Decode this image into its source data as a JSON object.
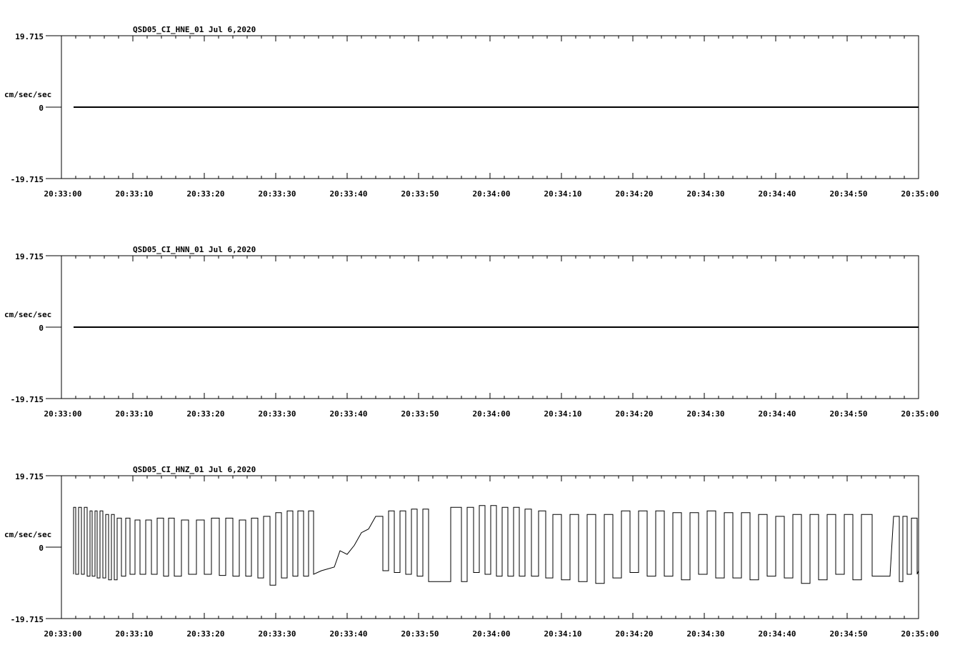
{
  "colors": {
    "background": "#ffffff",
    "ink": "#000000"
  },
  "chart_data": [
    {
      "type": "line",
      "title": "QSD05_CI_HNE_01  Jul 6,2020",
      "ylabel": "cm/sec/sec",
      "ylim": [
        -19.715,
        19.715
      ],
      "yticks": [
        19.715,
        0,
        -19.715
      ],
      "ytick_labels": [
        "19.715",
        "0",
        "-19.715"
      ],
      "xlim": [
        "20:33:00",
        "20:35:00"
      ],
      "xtick_labels": [
        "20:33:00",
        "20:33:10",
        "20:33:20",
        "20:33:30",
        "20:33:40",
        "20:33:50",
        "20:34:00",
        "20:34:10",
        "20:34:20",
        "20:34:30",
        "20:34:40",
        "20:34:50",
        "20:35:00"
      ],
      "series": [
        {
          "segments": [
            {
              "x": [
                "20:33:01.7",
                "20:35:00"
              ],
              "y": [
                0,
                0
              ]
            }
          ]
        }
      ]
    },
    {
      "type": "line",
      "title": "QSD05_CI_HNN_01  Jul 6,2020",
      "ylabel": "cm/sec/sec",
      "ylim": [
        -19.715,
        19.715
      ],
      "yticks": [
        19.715,
        0,
        -19.715
      ],
      "ytick_labels": [
        "19.715",
        "0",
        "-19.715"
      ],
      "xlim": [
        "20:33:00",
        "20:35:00"
      ],
      "xtick_labels": [
        "20:33:00",
        "20:33:10",
        "20:33:20",
        "20:33:30",
        "20:33:40",
        "20:33:50",
        "20:34:00",
        "20:34:10",
        "20:34:20",
        "20:34:30",
        "20:34:40",
        "20:34:50",
        "20:35:00"
      ],
      "series": [
        {
          "segments": [
            {
              "x": [
                "20:33:01.7",
                "20:35:00"
              ],
              "y": [
                0,
                0
              ]
            }
          ]
        }
      ]
    },
    {
      "type": "line",
      "title": "QSD05_CI_HNZ_01  Jul 6,2020",
      "ylabel": "cm/sec/sec",
      "ylim": [
        -19.715,
        19.715
      ],
      "yticks": [
        19.715,
        0,
        -19.715
      ],
      "ytick_labels": [
        "19.715",
        "0",
        "-19.715"
      ],
      "xlim": [
        "20:33:00",
        "20:35:00"
      ],
      "xtick_labels": [
        "20:33:00",
        "20:33:10",
        "20:33:20",
        "20:33:30",
        "20:33:40",
        "20:33:50",
        "20:34:00",
        "20:34:10",
        "20:34:20",
        "20:34:30",
        "20:34:40",
        "20:34:50",
        "20:35:00"
      ],
      "series": [
        {
          "segments": [
            {
              "x": [
                "20:33:01.7",
                "20:33:01.7",
                "20:33:02.0",
                "20:33:02.0",
                "20:33:02.4",
                "20:33:02.4",
                "20:33:02.8",
                "20:33:02.8",
                "20:33:03.2",
                "20:33:03.2",
                "20:33:03.6",
                "20:33:03.6",
                "20:33:04.0",
                "20:33:04.0",
                "20:33:04.3",
                "20:33:04.3",
                "20:33:04.7",
                "20:33:04.7",
                "20:33:05.0",
                "20:33:05.0",
                "20:33:05.4",
                "20:33:05.4",
                "20:33:05.8",
                "20:33:05.8",
                "20:33:06.2",
                "20:33:06.2",
                "20:33:06.6",
                "20:33:06.6",
                "20:33:07.0",
                "20:33:07.0",
                "20:33:07.4",
                "20:33:07.4",
                "20:33:07.8",
                "20:33:07.8",
                "20:33:08.4",
                "20:33:08.4",
                "20:33:09.0",
                "20:33:09.0",
                "20:33:09.6",
                "20:33:09.6",
                "20:33:10.3",
                "20:33:10.3",
                "20:33:11.0",
                "20:33:11.0",
                "20:33:11.8",
                "20:33:11.8",
                "20:33:12.6",
                "20:33:12.6",
                "20:33:13.4",
                "20:33:13.4",
                "20:33:14.3",
                "20:33:14.3",
                "20:33:15.0",
                "20:33:15.0",
                "20:33:15.8",
                "20:33:15.8",
                "20:33:16.8",
                "20:33:16.8",
                "20:33:17.8",
                "20:33:17.8",
                "20:33:18.9",
                "20:33:18.9",
                "20:33:20.0",
                "20:33:20.0",
                "20:33:21.0",
                "20:33:21.0",
                "20:33:22.1",
                "20:33:22.1",
                "20:33:23.0",
                "20:33:23.0",
                "20:33:24.0",
                "20:33:24.0",
                "20:33:24.9",
                "20:33:24.9",
                "20:33:25.8",
                "20:33:25.8",
                "20:33:26.6",
                "20:33:26.6",
                "20:33:27.5",
                "20:33:27.5",
                "20:33:28.3",
                "20:33:28.3",
                "20:33:29.2",
                "20:33:29.2",
                "20:33:30.0",
                "20:33:30.0",
                "20:33:30.8",
                "20:33:30.8",
                "20:33:31.6",
                "20:33:31.6",
                "20:33:32.4",
                "20:33:32.4",
                "20:33:33.1",
                "20:33:33.1",
                "20:33:33.9",
                "20:33:33.9",
                "20:33:34.6",
                "20:33:34.6",
                "20:33:35.3",
                "20:33:35.3",
                "20:33:36.4",
                "20:33:38.2",
                "20:33:39.0",
                "20:33:40.0",
                "20:33:41.0",
                "20:33:42.0",
                "20:33:43.0",
                "20:33:44.0",
                "20:33:45.0",
                "20:33:45.0",
                "20:33:45.8",
                "20:33:45.8",
                "20:33:46.6",
                "20:33:46.6",
                "20:33:47.4",
                "20:33:47.4",
                "20:33:48.2",
                "20:33:48.2",
                "20:33:49.0",
                "20:33:49.0",
                "20:33:49.8",
                "20:33:49.8",
                "20:33:50.6",
                "20:33:50.6",
                "20:33:51.4",
                "20:33:51.4",
                "20:33:54.5",
                "20:33:54.5",
                "20:33:56.0",
                "20:33:56.0",
                "20:33:56.8",
                "20:33:56.8",
                "20:33:57.7",
                "20:33:57.7",
                "20:33:58.5",
                "20:33:58.5",
                "20:33:59.3",
                "20:33:59.3",
                "20:34:00.1",
                "20:34:00.1",
                "20:34:00.9",
                "20:34:00.9",
                "20:34:01.7",
                "20:34:01.7",
                "20:34:02.5",
                "20:34:02.5",
                "20:34:03.3",
                "20:34:03.3",
                "20:34:04.1",
                "20:34:04.1",
                "20:34:04.9",
                "20:34:04.9",
                "20:34:05.8",
                "20:34:05.8",
                "20:34:06.8",
                "20:34:06.8",
                "20:34:07.8",
                "20:34:07.8",
                "20:34:08.8",
                "20:34:08.8",
                "20:34:10.0",
                "20:34:10.0",
                "20:34:11.2",
                "20:34:11.2",
                "20:34:12.4",
                "20:34:12.4",
                "20:34:13.6",
                "20:34:13.6",
                "20:34:14.8",
                "20:34:14.8",
                "20:34:16.0",
                "20:34:16.0",
                "20:34:17.2",
                "20:34:17.2",
                "20:34:18.4",
                "20:34:18.4",
                "20:34:19.6",
                "20:34:19.6",
                "20:34:20.8",
                "20:34:20.8",
                "20:34:22.0",
                "20:34:22.0",
                "20:34:23.2",
                "20:34:23.2",
                "20:34:24.4",
                "20:34:24.4",
                "20:34:25.6",
                "20:34:25.6",
                "20:34:26.8",
                "20:34:26.8",
                "20:34:28.0",
                "20:34:28.0",
                "20:34:29.2",
                "20:34:29.2",
                "20:34:30.4",
                "20:34:30.4",
                "20:34:31.6",
                "20:34:31.6",
                "20:34:32.8",
                "20:34:32.8",
                "20:34:34.0",
                "20:34:34.0",
                "20:34:35.2",
                "20:34:35.2",
                "20:34:36.4",
                "20:34:36.4",
                "20:34:37.6",
                "20:34:37.6",
                "20:34:38.8",
                "20:34:38.8",
                "20:34:40.0",
                "20:34:40.0",
                "20:34:41.2",
                "20:34:41.2",
                "20:34:42.4",
                "20:34:42.4",
                "20:34:43.6",
                "20:34:43.6",
                "20:34:44.8",
                "20:34:44.8",
                "20:34:46.0",
                "20:34:46.0",
                "20:34:47.2",
                "20:34:47.2",
                "20:34:48.4",
                "20:34:48.4",
                "20:34:49.6",
                "20:34:49.6",
                "20:34:50.8",
                "20:34:50.8",
                "20:34:52.0",
                "20:34:52.0",
                "20:34:53.5",
                "20:34:53.5",
                "20:34:56.0",
                "20:34:56.5",
                "20:34:57.3",
                "20:34:57.3",
                "20:34:57.8",
                "20:34:57.8",
                "20:34:58.4",
                "20:34:58.4",
                "20:34:59.0",
                "20:34:59.0",
                "20:34:59.8",
                "20:34:59.8",
                "20:35:00"
              ],
              "y": [
                -7.5,
                11.0,
                11.0,
                -7.5,
                -7.5,
                11.0,
                11.0,
                -7.5,
                -7.5,
                11.0,
                11.0,
                -8.0,
                -8.0,
                10.0,
                10.0,
                -8.0,
                -8.0,
                10.0,
                10.0,
                -8.5,
                -8.5,
                10.0,
                10.0,
                -8.5,
                -8.5,
                9.0,
                9.0,
                -9.0,
                -9.0,
                9.0,
                9.0,
                -9.0,
                -9.0,
                8.0,
                8.0,
                -8.0,
                -8.0,
                8.0,
                8.0,
                -7.5,
                -7.5,
                7.5,
                7.5,
                -7.5,
                -7.5,
                7.5,
                7.5,
                -7.5,
                -7.5,
                8.0,
                8.0,
                -8.0,
                -8.0,
                8.0,
                8.0,
                -8.0,
                -8.0,
                7.5,
                7.5,
                -7.5,
                -7.5,
                7.5,
                7.5,
                -7.5,
                -7.5,
                8.0,
                8.0,
                -7.8,
                -7.8,
                8.0,
                8.0,
                -8.0,
                -8.0,
                7.5,
                7.5,
                -8.0,
                -8.0,
                8.0,
                8.0,
                -8.5,
                -8.5,
                8.5,
                8.5,
                -10.5,
                -10.5,
                9.5,
                9.5,
                -8.5,
                -8.5,
                10.0,
                10.0,
                -8.0,
                -8.0,
                10.0,
                10.0,
                -8.0,
                -8.0,
                10.0,
                10.0,
                -7.5,
                -6.5,
                -5.5,
                -1.0,
                -2.0,
                0.5,
                4.0,
                5.0,
                8.5,
                8.5,
                -6.5,
                -6.5,
                10.0,
                10.0,
                -7.0,
                -7.0,
                10.0,
                10.0,
                -7.5,
                -7.5,
                10.5,
                10.5,
                -8.0,
                -8.0,
                10.5,
                10.5,
                -9.5,
                -9.5,
                11.0,
                11.0,
                -9.5,
                -9.5,
                11.0,
                11.0,
                -7.0,
                -7.0,
                11.5,
                11.5,
                -7.5,
                -7.5,
                11.5,
                11.5,
                -8.0,
                -8.0,
                11.0,
                11.0,
                -8.0,
                -8.0,
                11.0,
                11.0,
                -8.0,
                -8.0,
                10.5,
                10.5,
                -8.0,
                -8.0,
                10.0,
                10.0,
                -8.5,
                -8.5,
                9.0,
                9.0,
                -9.0,
                -9.0,
                9.0,
                9.0,
                -9.5,
                -9.5,
                9.0,
                9.0,
                -10.0,
                -10.0,
                9.0,
                9.0,
                -8.5,
                -8.5,
                10.0,
                10.0,
                -7.0,
                -7.0,
                10.0,
                10.0,
                -8.0,
                -8.0,
                10.0,
                10.0,
                -8.0,
                -8.0,
                9.5,
                9.5,
                -9.0,
                -9.0,
                9.5,
                9.5,
                -7.5,
                -7.5,
                10.0,
                10.0,
                -8.5,
                -8.5,
                9.5,
                9.5,
                -8.5,
                -8.5,
                9.5,
                9.5,
                -9.0,
                -9.0,
                9.0,
                9.0,
                -8.0,
                -8.0,
                8.5,
                8.5,
                -8.5,
                -8.5,
                9.0,
                9.0,
                -10.0,
                -10.0,
                9.0,
                9.0,
                -9.0,
                -9.0,
                9.0,
                9.0,
                -7.5,
                -7.5,
                9.0,
                9.0,
                -9.0,
                -9.0,
                9.0,
                9.0,
                -8.0,
                -8.0,
                8.5,
                8.5,
                -9.5,
                -9.5,
                8.5,
                8.5,
                -7.5,
                -7.5,
                8.0,
                8.0,
                -7.5,
                -6.5,
                -11.0,
                -11.0,
                13.5,
                13.5,
                -5.5,
                -5.5,
                12.5,
                12.5,
                -7.0,
                -7.0,
                11.0,
                11.0,
                -8.5,
                -8.5,
                11.0
              ]
            }
          ]
        }
      ]
    }
  ]
}
